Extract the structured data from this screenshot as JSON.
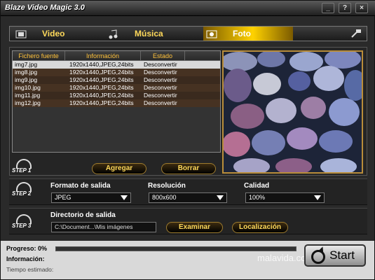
{
  "app": {
    "title": "Blaze Video Magic 3.0"
  },
  "window_buttons": {
    "min": "_",
    "help": "?",
    "close": "×"
  },
  "tabs": [
    {
      "label": "Video"
    },
    {
      "label": "Música"
    },
    {
      "label": "Foto"
    }
  ],
  "list": {
    "headers": [
      "Fichero fuente",
      "Información",
      "Estado"
    ],
    "rows": [
      {
        "file": "img7.jpg",
        "info": "1920x1440,JPEG,24bits",
        "status": "Desconvertir"
      },
      {
        "file": "img8.jpg",
        "info": "1920x1440,JPEG,24bits",
        "status": "Desconvertir"
      },
      {
        "file": "img9.jpg",
        "info": "1920x1440,JPEG,24bits",
        "status": "Desconvertir"
      },
      {
        "file": "img10.jpg",
        "info": "1920x1440,JPEG,24bits",
        "status": "Desconvertir"
      },
      {
        "file": "img11.jpg",
        "info": "1920x1440,JPEG,24bits",
        "status": "Desconvertir"
      },
      {
        "file": "img12.jpg",
        "info": "1920x1440,JPEG,24bits",
        "status": "Desconvertir"
      }
    ]
  },
  "buttons": {
    "add": "Agregar",
    "remove": "Borrar",
    "browse": "Examinar",
    "locate": "Localización",
    "start": "Start"
  },
  "steps": {
    "s1": "STEP 1",
    "s2": "STEP 2",
    "s3": "STEP 3"
  },
  "output": {
    "format_label": "Formato de salida",
    "format_value": "JPEG",
    "resolution_label": "Resolución",
    "resolution_value": "800x600",
    "quality_label": "Calidad",
    "quality_value": "100%",
    "dir_label": "Directorio de salida",
    "dir_value": "C:\\Document...\\Mis imágenes"
  },
  "status": {
    "progress_label": "Progreso:",
    "progress_value": "0%",
    "info_label": "Información:",
    "time_label": "Tiempo estimado:"
  },
  "watermark": "malavida.com",
  "colors": {
    "accent": "#ffd95a",
    "tab_active": "#ffd200"
  }
}
